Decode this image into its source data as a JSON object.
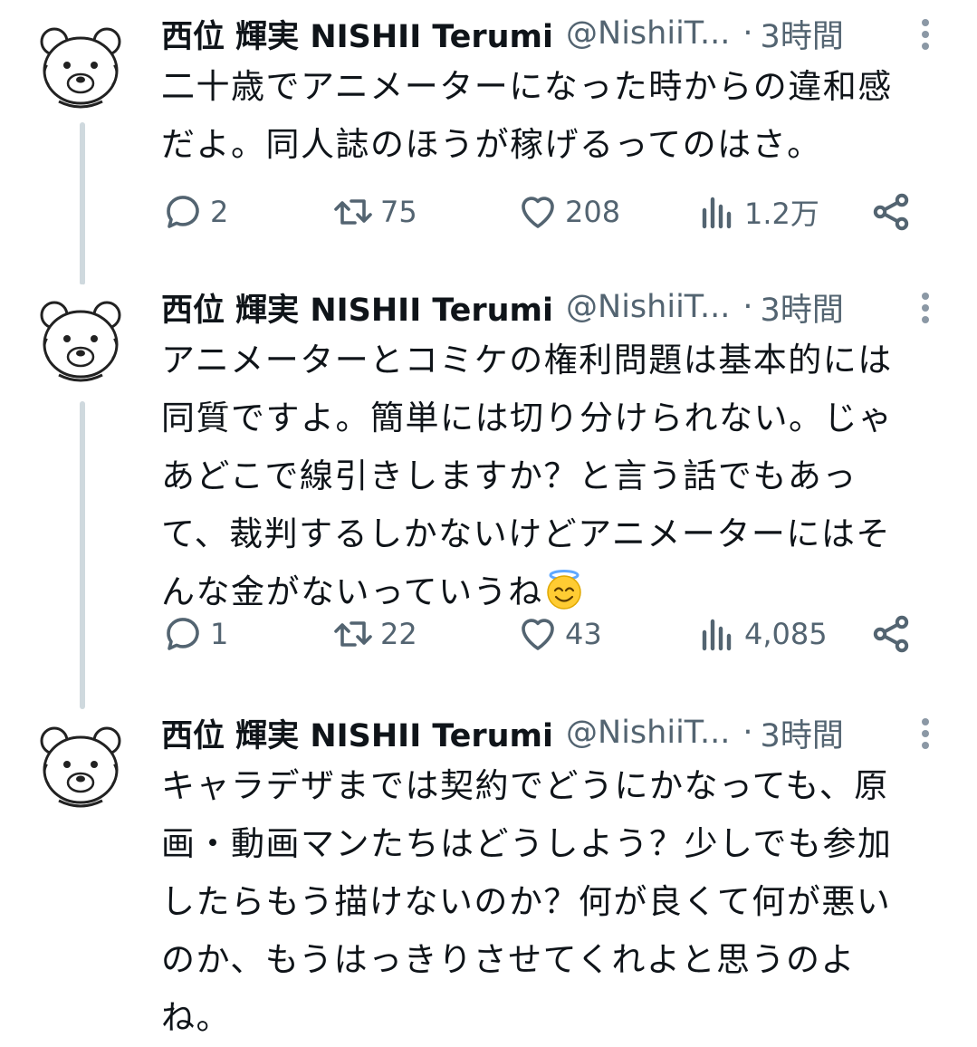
{
  "tweets": [
    {
      "name": "西位 輝実 NISHII Terumi",
      "handle": "@NishiiT...",
      "separator": "·",
      "time": "3時間",
      "text": "二十歳でアニメーターになった時からの違和感\nだよ。同人誌のほうが稼げるってのはさ。",
      "replies": "2",
      "retweets": "75",
      "likes": "208",
      "views": "1.2万"
    },
    {
      "name": "西位 輝実 NISHII Terumi",
      "handle": "@NishiiT...",
      "separator": "·",
      "time": "3時間",
      "text": "アニメーターとコミケの権利問題は基本的には\n同質ですよ。簡単には切り分けられない。じゃ\nあどこで線引きしますか？と言う話でもあっ\nて、裁判するしかないけどアニメーターにはそ\nんな金がないっていうね",
      "emoji": "smiling-face-with-halo",
      "replies": "1",
      "retweets": "22",
      "likes": "43",
      "views": "4,085"
    },
    {
      "name": "西位 輝実 NISHII Terumi",
      "handle": "@NishiiT...",
      "separator": "·",
      "time": "3時間",
      "text": "キャラデザまでは契約でどうにかなっても、原\n画・動画マンたちはどうしよう？少しでも参加\nしたらもう描けないのか？何が良くて何が悪い\nのか、もうはっきりさせてくれよと思うのよ\nね。"
    }
  ],
  "colors": {
    "text": "#0f1419",
    "muted": "#536471",
    "thread_line": "#cfd9de",
    "emoji_face": "#ffcc33",
    "halo": "#5fa8ff"
  }
}
